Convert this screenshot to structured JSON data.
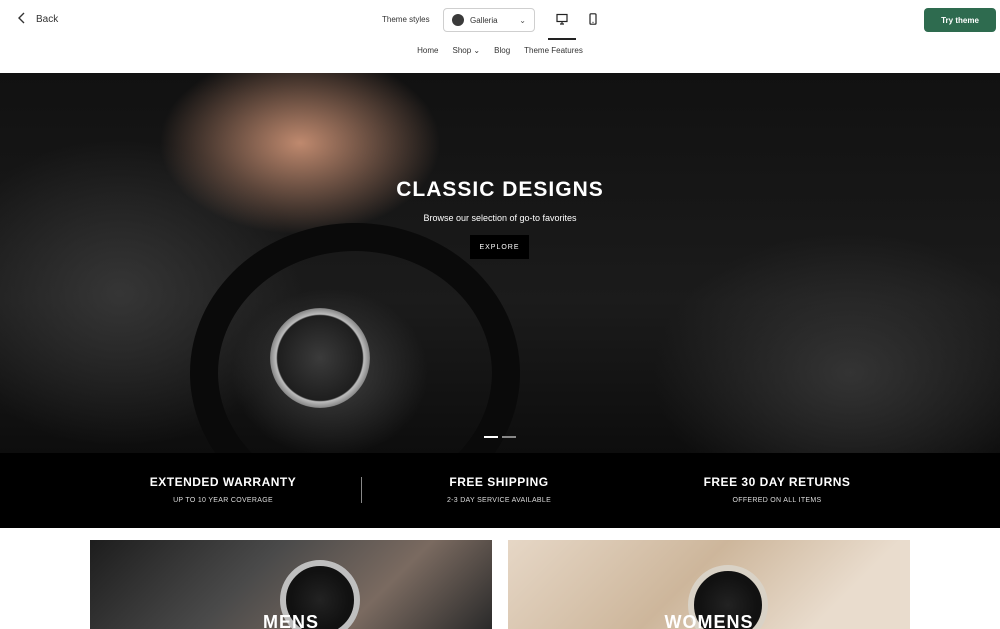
{
  "toolbar": {
    "back_label": "Back",
    "styles_label": "Theme styles",
    "style_value": "Galleria",
    "try_label": "Try theme",
    "accent": "#2e6b4f"
  },
  "nav": {
    "items": [
      "Home",
      "Shop",
      "Blog",
      "Theme Features"
    ]
  },
  "hero": {
    "title": "CLASSIC DESIGNS",
    "subtitle": "Browse our selection of go-to favorites",
    "button": "EXPLORE"
  },
  "features": [
    {
      "title": "EXTENDED WARRANTY",
      "sub": "UP TO 10 YEAR COVERAGE"
    },
    {
      "title": "FREE SHIPPING",
      "sub": "2-3 DAY SERVICE AVAILABLE"
    },
    {
      "title": "FREE 30 DAY RETURNS",
      "sub": "OFFERED ON ALL ITEMS"
    }
  ],
  "collections": [
    {
      "label": "MENS"
    },
    {
      "label": "WOMENS"
    }
  ]
}
